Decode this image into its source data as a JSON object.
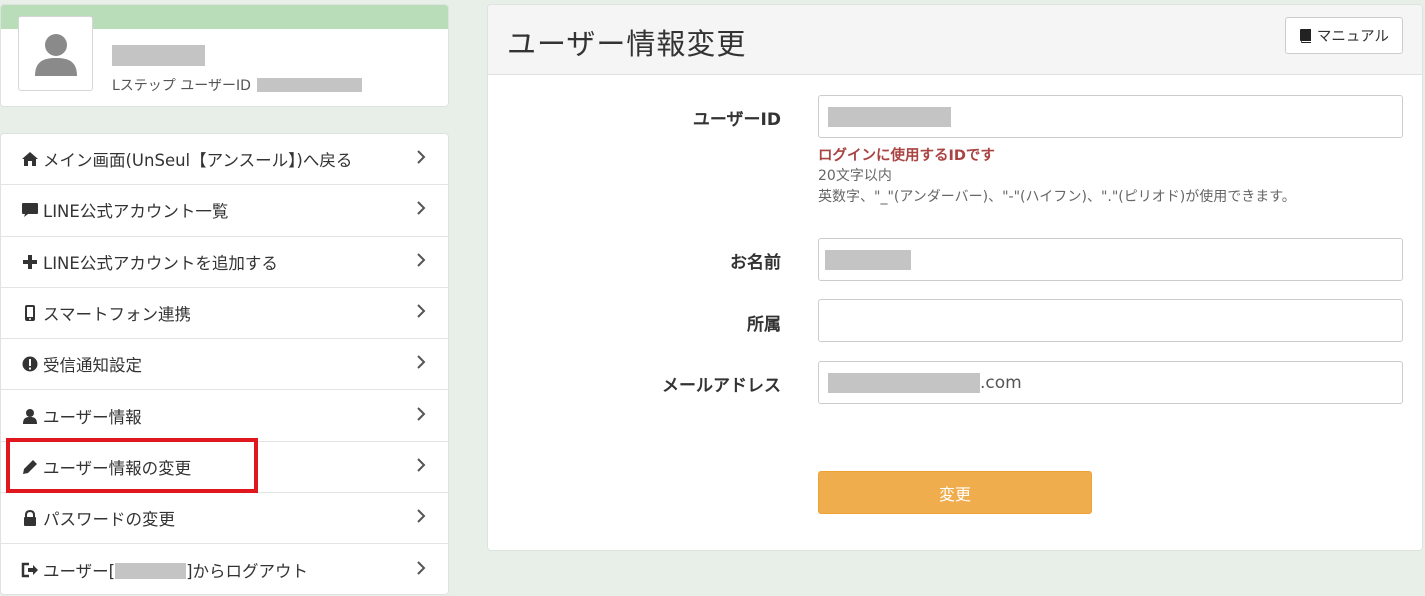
{
  "profile": {
    "id_prefix": "Lステップ ユーザーID"
  },
  "menu": {
    "items": [
      {
        "icon": "home-icon",
        "label": "メイン画面(UnSeul【アンスール】)へ戻る"
      },
      {
        "icon": "comment-icon",
        "label": "LINE公式アカウント一覧"
      },
      {
        "icon": "plus-icon",
        "label": "LINE公式アカウントを追加する"
      },
      {
        "icon": "mobile-phone-icon",
        "label": "スマートフォン連携"
      },
      {
        "icon": "exclamation-circle-icon",
        "label": "受信通知設定"
      },
      {
        "icon": "user-icon",
        "label": "ユーザー情報"
      },
      {
        "icon": "pencil-icon",
        "label": "ユーザー情報の変更"
      },
      {
        "icon": "lock-icon",
        "label": "パスワードの変更"
      },
      {
        "icon": "logout-icon",
        "label_before": "ユーザー[",
        "label_after": "]からログアウト"
      }
    ],
    "highlight_color": "#e1171e"
  },
  "panel": {
    "title": "ユーザー情報変更",
    "manual_label": "マニュアル",
    "fields": {
      "user_id_label": "ユーザーID",
      "user_id_help_red": "ログインに使用するIDです",
      "user_id_help_1": "20文字以内",
      "user_id_help_2": "英数字、\"_\"(アンダーバー)、\"-\"(ハイフン)、\".\"(ピリオド)が使用できます。",
      "name_label": "お名前",
      "affiliation_label": "所属",
      "affiliation_value": "",
      "email_label": "メールアドレス",
      "email_suffix": ".com"
    },
    "submit_label": "変更",
    "submit_color": "#f0ad4e"
  },
  "colors": {
    "background": "#e8efe9",
    "profile_band": "#b9dcb9",
    "error_text": "#a94442"
  }
}
